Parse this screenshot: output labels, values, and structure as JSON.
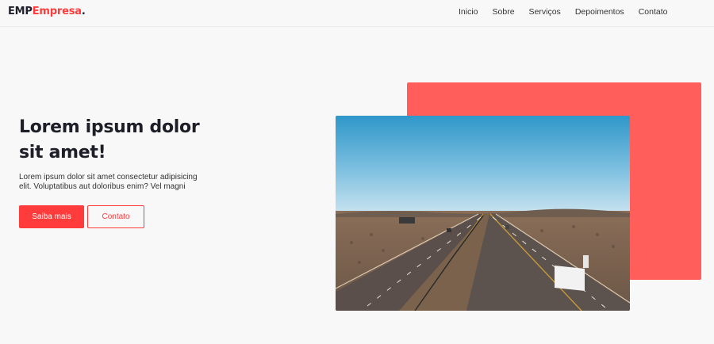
{
  "header": {
    "logo": {
      "part1": "EMP",
      "part2": "Empresa",
      "part3": "."
    },
    "nav": [
      "Inicio",
      "Sobre",
      "Serviços",
      "Depoimentos",
      "Contato"
    ]
  },
  "hero": {
    "title_line1": "Lorem ipsum dolor",
    "title_line2": "sit amet!",
    "text": "Lorem ipsum dolor sit amet consectetur adipisicing elit. Voluptatibus aut doloribus enim? Vel magni",
    "primary_button": "Saiba mais",
    "secondary_button": "Contato"
  },
  "colors": {
    "accent": "#ff3b3b",
    "accent_box": "#ff5e5b",
    "background": "#f8f8f8",
    "heading": "#1e1e28"
  },
  "image": {
    "subject": "highway-through-desert-photo"
  }
}
